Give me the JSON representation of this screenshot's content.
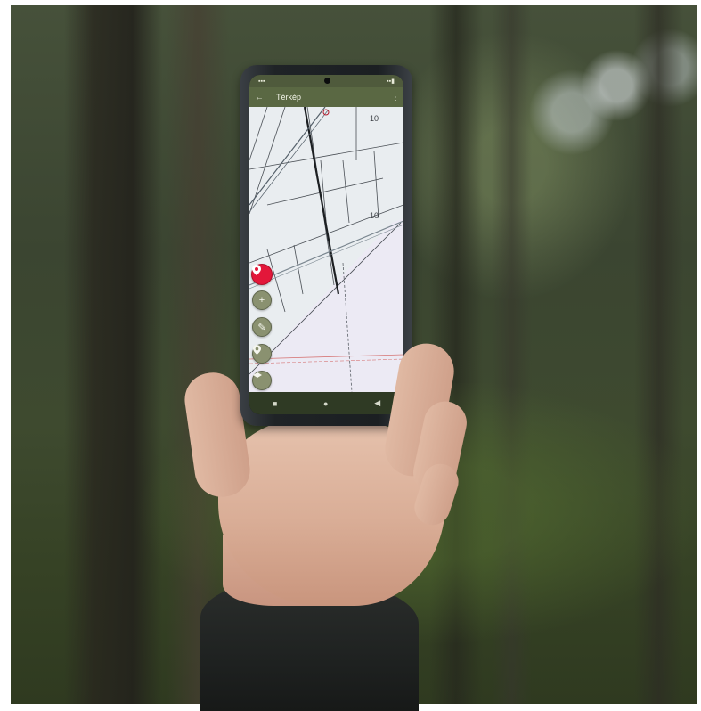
{
  "map_app": {
    "title": "Térkép",
    "parcel_labels": [
      "10",
      "10"
    ],
    "icons": {
      "back": "arrow-back-icon",
      "menu": "more-vert-icon",
      "location": "location-pin-icon",
      "add": "plus-icon",
      "draw": "pencil-icon",
      "marker": "map-marker-icon",
      "layers": "layers-icon"
    }
  },
  "nav": {
    "recents": "■",
    "home": "●",
    "back": "◀"
  },
  "colors": {
    "app_bar": "#5a6843",
    "location_button": "#e3173a",
    "map_background": "#e8ecef"
  }
}
